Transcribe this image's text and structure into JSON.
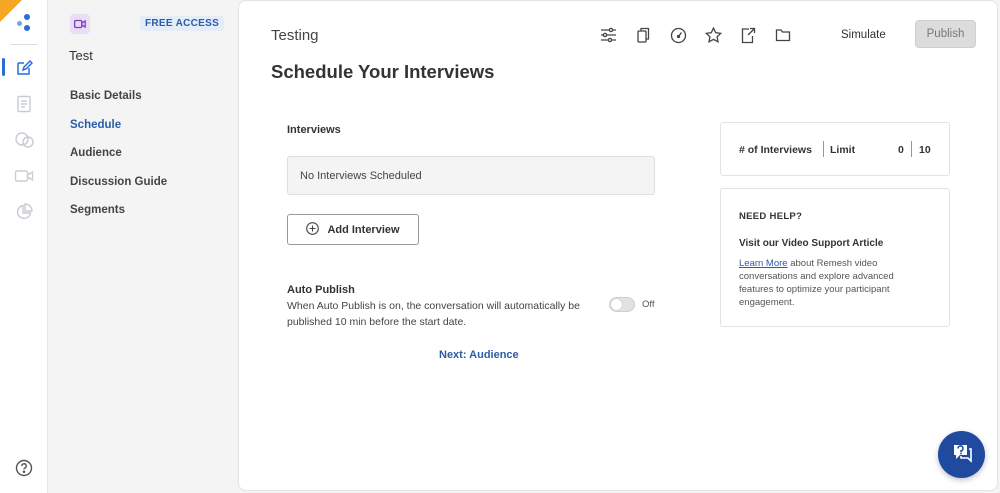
{
  "sidebar": {
    "badge": "FREE ACCESS",
    "project_name": "Test",
    "nav": [
      "Basic Details",
      "Schedule",
      "Audience",
      "Discussion Guide",
      "Segments"
    ],
    "active_index": 1
  },
  "header": {
    "breadcrumb": "Testing",
    "title": "Schedule Your Interviews",
    "simulate_label": "Simulate",
    "publish_label": "Publish"
  },
  "interviews": {
    "label": "Interviews",
    "empty_text": "No Interviews Scheduled",
    "add_label": "Add Interview"
  },
  "auto_publish": {
    "title": "Auto Publish",
    "description": "When Auto Publish is on, the conversation will automatically be published 10 min before the start date.",
    "state_label": "Off"
  },
  "next_label": "Next: Audience",
  "stats": {
    "count_label": "# of Interviews",
    "limit_label": "Limit",
    "count": "0",
    "limit": "10"
  },
  "help": {
    "heading": "NEED HELP?",
    "subheading": "Visit our Video Support Article",
    "link_text": "Learn More",
    "body_text": " about Remesh video conversations and explore advanced features to optimize your participant engagement."
  },
  "colors": {
    "accent": "#2a5ca8",
    "badge_bg": "#e4ecf8",
    "fab": "#1f4aa0",
    "corner": "#f5a623"
  },
  "icons": [
    "logo-icon",
    "edit-icon",
    "document-icon",
    "chat-bubbles-icon",
    "video-icon",
    "pie-chart-icon",
    "help-circle-icon",
    "sliders-icon",
    "copy-icon",
    "gauge-icon",
    "star-icon",
    "export-icon",
    "folder-icon",
    "plus-circle-icon",
    "support-chat-icon"
  ]
}
